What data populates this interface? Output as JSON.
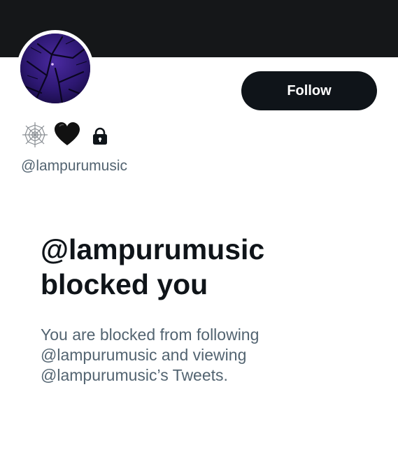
{
  "profile": {
    "handle": "@lampurumusic",
    "name_icons": [
      "spiderweb-icon",
      "black-heart-icon",
      "lock-icon"
    ],
    "follow_label": "Follow"
  },
  "blocked": {
    "title_line1": "@lampurumusic",
    "title_line2": "blocked you",
    "desc_line1": "You are blocked from following",
    "desc_line2": "@lampurumusic and viewing",
    "desc_line3": "@lampurumusic’s Tweets."
  },
  "colors": {
    "banner": "#151719",
    "button_bg": "#0f1419",
    "text_primary": "#0f1419",
    "text_secondary": "#536471",
    "avatar_bg": "#2a1660"
  }
}
